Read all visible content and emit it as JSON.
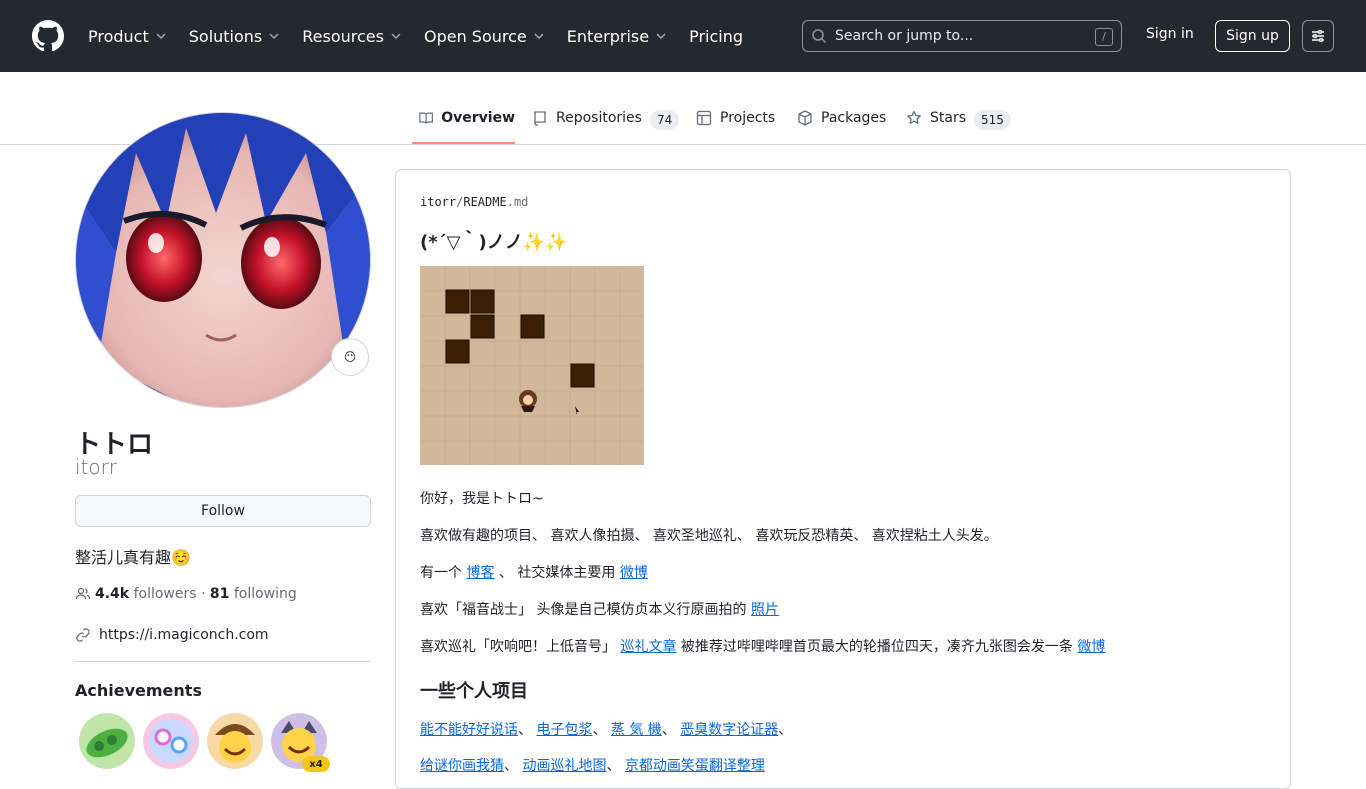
{
  "header": {
    "nav": [
      {
        "label": "Product"
      },
      {
        "label": "Solutions"
      },
      {
        "label": "Resources"
      },
      {
        "label": "Open Source"
      },
      {
        "label": "Enterprise"
      },
      {
        "label": "Pricing"
      }
    ],
    "search_placeholder": "Search or jump to...",
    "search_shortcut": "/",
    "sign_in": "Sign in",
    "sign_up": "Sign up"
  },
  "tabs": [
    {
      "label": "Overview",
      "icon": "book-icon"
    },
    {
      "label": "Repositories",
      "count": "74",
      "icon": "repo-icon"
    },
    {
      "label": "Projects",
      "icon": "table-icon"
    },
    {
      "label": "Packages",
      "icon": "package-icon"
    },
    {
      "label": "Stars",
      "count": "515",
      "icon": "star-icon"
    }
  ],
  "profile": {
    "name": "トトロ",
    "username": "itorr",
    "status_emoji": "😶",
    "follow_label": "Follow",
    "bio": "整活儿真有趣☺️",
    "followers_count": "4.4k",
    "followers_label": "followers",
    "dot": "·",
    "following_count": "81",
    "following_label": "following",
    "website": "https://i.magiconch.com",
    "achievements_title": "Achievements",
    "achievement_multiplier": "x4"
  },
  "readme": {
    "owner": "itorr",
    "sep": "/",
    "file": "README",
    "ext": ".md",
    "heading": "(*´▽｀)ノノ✨✨",
    "line1": "你好，我是トトロ~",
    "line2": "喜欢做有趣的项目、 喜欢人像拍摄、 喜欢圣地巡礼、 喜欢玩反恐精英、 喜欢捏粘土人头发。",
    "line3_pre": "有一个 ",
    "line3_link1": "博客",
    "line3_mid": " 、 社交媒体主要用 ",
    "line3_link2": "微博",
    "line4_pre": "喜欢「福音战士」 头像是自己模仿贞本义行原画拍的 ",
    "line4_link": "照片",
    "line5_pre": "喜欢巡礼「吹响吧！上低音号」 ",
    "line5_link1": "巡礼文章",
    "line5_mid": " 被推荐过哔哩哔哩首页最大的轮播位四天，凑齐九张图会发一条 ",
    "line5_link2": "微博",
    "section_title": "一些个人项目",
    "projects_row1": [
      "能不能好好说话",
      "电子包浆",
      "蒸 気 機",
      "恶臭数字论证器"
    ],
    "projects_row2": [
      "给谜你画我猜",
      "动画巡礼地图",
      "京都动画笑蛋翻译整理"
    ],
    "project_sep": "、"
  },
  "colors": {
    "header_bg": "#24292f",
    "link": "#0969da",
    "tab_underline": "#fd8c73",
    "border": "#d0d7de"
  }
}
